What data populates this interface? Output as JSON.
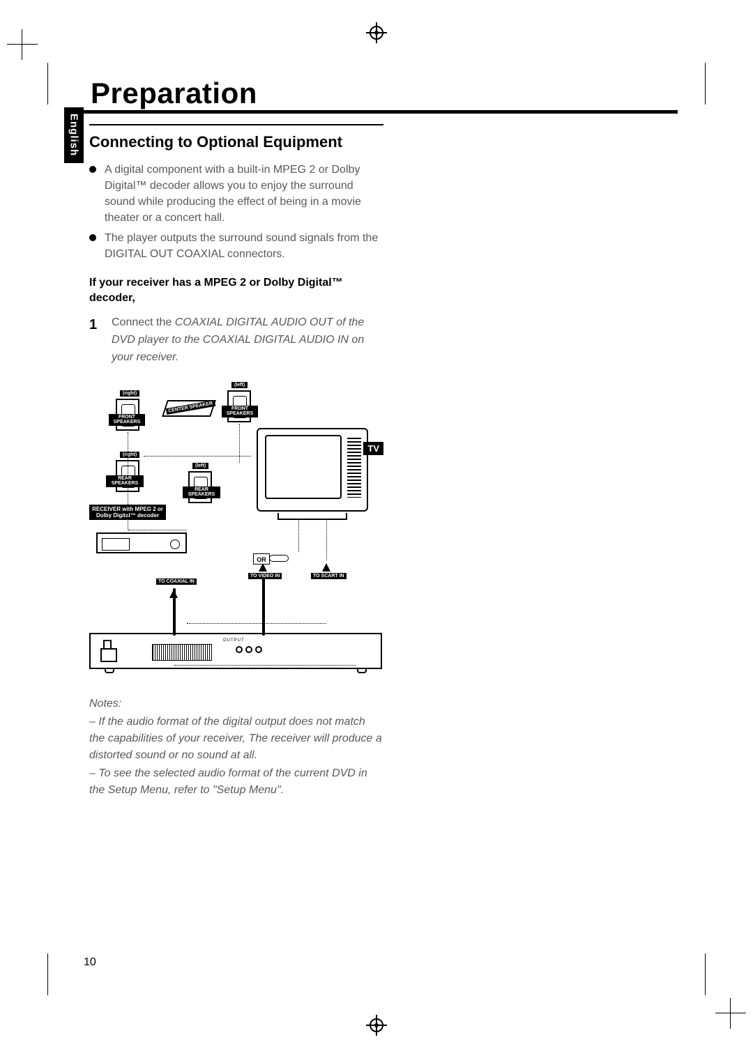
{
  "language_tab": "English",
  "chapter_title": "Preparation",
  "section_heading": "Connecting to Optional Equipment",
  "bullets": [
    "A digital component with a built-in MPEG 2 or Dolby Digital™ decoder allows you to enjoy the surround sound while producing the effect of being in a movie theater or a concert hall.",
    "The player outputs the surround sound signals from the DIGITAL OUT COAXIAL connectors."
  ],
  "sub_heading": "If your receiver has a MPEG 2 or Dolby Digital™ decoder,",
  "step": {
    "number": "1",
    "text_before": "Connect the ",
    "text_italic": "COAXIAL DIGITAL AUDIO OUT of the DVD player to the COAXIAL DIGITAL AUDIO IN on your receiver."
  },
  "diagram": {
    "tv_label": "TV",
    "front_speakers": "FRONT SPEAKERS",
    "rear_speakers": "REAR SPEAKERS",
    "center_speaker": "CENTER SPEAKER",
    "left": "(left)",
    "right": "(right)",
    "receiver_label": "RECEIVER with MPEG 2 or Dolby Digital™ decoder",
    "or": "OR",
    "to_coaxial_in": "TO COAXIAL IN",
    "to_video_in": "TO VIDEO IN",
    "to_scart_in": "TO SCART IN",
    "output": "OUTPUT"
  },
  "notes": {
    "label": "Notes:",
    "items": [
      "–   If the audio format of the digital output does not match the capabilities of your receiver, The receiver will produce a distorted sound or no sound at all.",
      "–   To see the selected audio format of the current DVD in the Setup Menu, refer to \"Setup Menu\"."
    ]
  },
  "page_number": "10"
}
